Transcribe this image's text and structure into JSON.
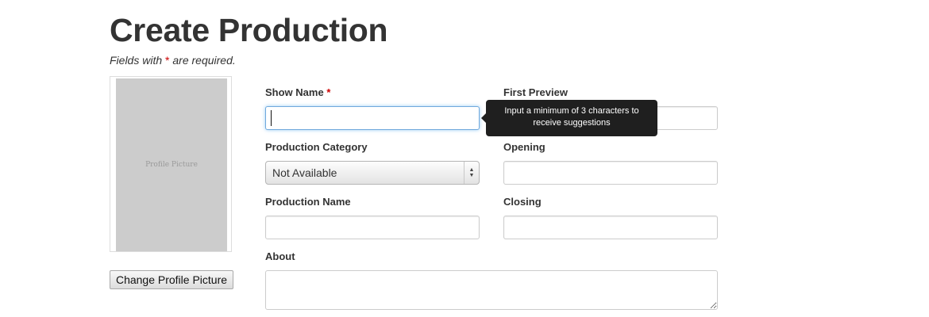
{
  "page": {
    "title": "Create Production",
    "required_note_prefix": "Fields with ",
    "required_marker": "*",
    "required_note_suffix": " are required."
  },
  "profile": {
    "placeholder_text": "Profile Picture",
    "change_button_label": "Change Profile Picture"
  },
  "form": {
    "show_name": {
      "label": "Show Name",
      "required_marker": "*",
      "value": ""
    },
    "first_preview": {
      "label": "First Preview",
      "value": ""
    },
    "production_category": {
      "label": "Production Category",
      "selected": "Not Available"
    },
    "opening": {
      "label": "Opening",
      "value": ""
    },
    "production_name": {
      "label": "Production Name",
      "value": ""
    },
    "closing": {
      "label": "Closing",
      "value": ""
    },
    "about": {
      "label": "About",
      "value": ""
    }
  },
  "tooltip": {
    "text": "Input a minimum of 3 characters to receive suggestions"
  },
  "colors": {
    "required_marker": "#cc0000",
    "focus_border": "#6fa8dc",
    "tooltip_bg": "#1f1f1f"
  },
  "icons": {
    "select_arrows": "up-down-arrows-icon"
  }
}
